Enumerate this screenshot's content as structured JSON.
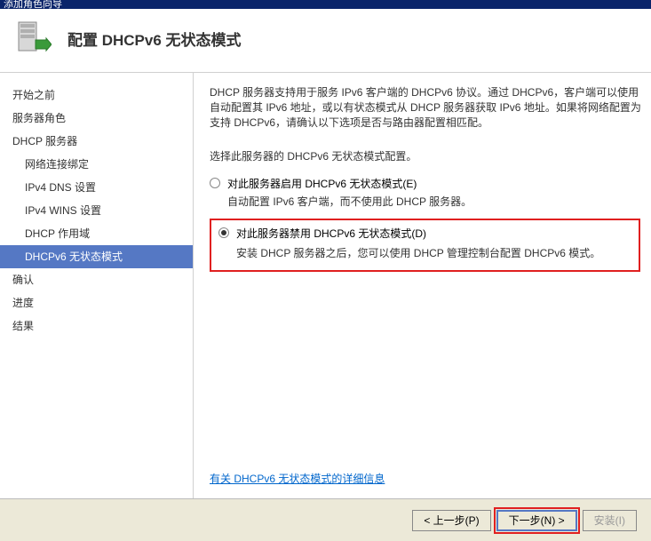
{
  "titlebar": "添加角色向导",
  "header": {
    "title": "配置 DHCPv6 无状态模式"
  },
  "sidebar": {
    "items": [
      {
        "label": "开始之前",
        "sub": false,
        "sel": false
      },
      {
        "label": "服务器角色",
        "sub": false,
        "sel": false
      },
      {
        "label": "DHCP 服务器",
        "sub": false,
        "sel": false
      },
      {
        "label": "网络连接绑定",
        "sub": true,
        "sel": false
      },
      {
        "label": "IPv4 DNS 设置",
        "sub": true,
        "sel": false
      },
      {
        "label": "IPv4 WINS 设置",
        "sub": true,
        "sel": false
      },
      {
        "label": "DHCP 作用域",
        "sub": true,
        "sel": false
      },
      {
        "label": "DHCPv6 无状态模式",
        "sub": true,
        "sel": true
      },
      {
        "label": "确认",
        "sub": false,
        "sel": false
      },
      {
        "label": "进度",
        "sub": false,
        "sel": false
      },
      {
        "label": "结果",
        "sub": false,
        "sel": false
      }
    ]
  },
  "main": {
    "description": "DHCP 服务器支持用于服务 IPv6 客户端的 DHCPv6 协议。通过 DHCPv6，客户端可以使用自动配置其 IPv6 地址，或以有状态模式从 DHCP 服务器获取 IPv6 地址。如果将网络配置为支持 DHCPv6，请确认以下选项是否与路由器配置相匹配。",
    "instruction": "选择此服务器的 DHCPv6 无状态模式配置。",
    "option1": {
      "label": "对此服务器启用 DHCPv6 无状态模式(E)",
      "sub": "自动配置 IPv6 客户端，而不使用此 DHCP 服务器。"
    },
    "option2": {
      "label": "对此服务器禁用 DHCPv6 无状态模式(D)",
      "sub": "安装 DHCP 服务器之后，您可以使用 DHCP 管理控制台配置 DHCPv6 模式。"
    },
    "link": "有关 DHCPv6 无状态模式的详细信息"
  },
  "footer": {
    "prev": "< 上一步(P)",
    "next": "下一步(N) >",
    "install": "安装(I)"
  }
}
